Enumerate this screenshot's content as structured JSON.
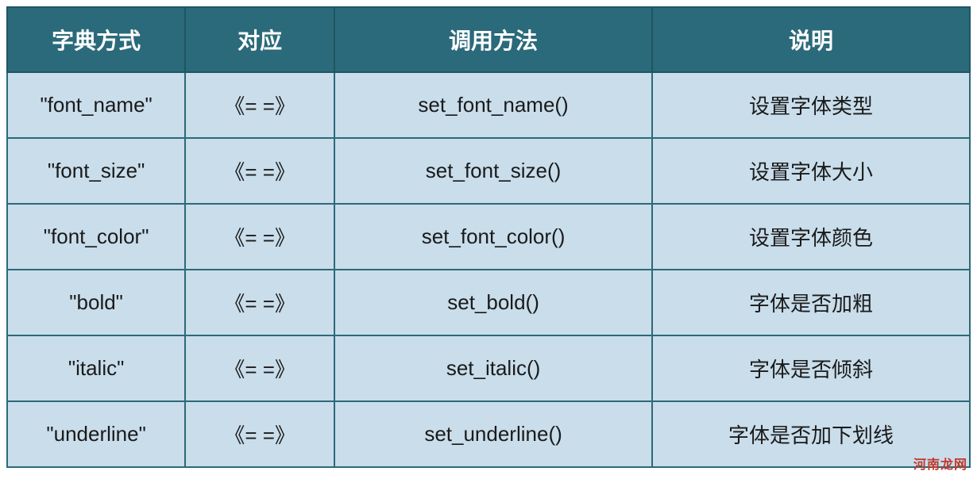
{
  "table": {
    "headers": [
      "字典方式",
      "对应",
      "调用方法",
      "说明"
    ],
    "rows": [
      {
        "dict": "\"font_name\"",
        "corr": "《=  =》",
        "method": "set_font_name()",
        "desc": "设置字体类型"
      },
      {
        "dict": "\"font_size\"",
        "corr": "《=  =》",
        "method": "set_font_size()",
        "desc": "设置字体大小"
      },
      {
        "dict": "\"font_color\"",
        "corr": "《=  =》",
        "method": "set_font_color()",
        "desc": "设置字体颜色"
      },
      {
        "dict": "\"bold\"",
        "corr": "《=  =》",
        "method": "set_bold()",
        "desc": "字体是否加粗"
      },
      {
        "dict": "\"italic\"",
        "corr": "《=  =》",
        "method": "set_italic()",
        "desc": "字体是否倾斜"
      },
      {
        "dict": "\"underline\"",
        "corr": "《=  =》",
        "method": "set_underline()",
        "desc": "字体是否加下划线"
      }
    ]
  },
  "watermark": "河南龙网"
}
